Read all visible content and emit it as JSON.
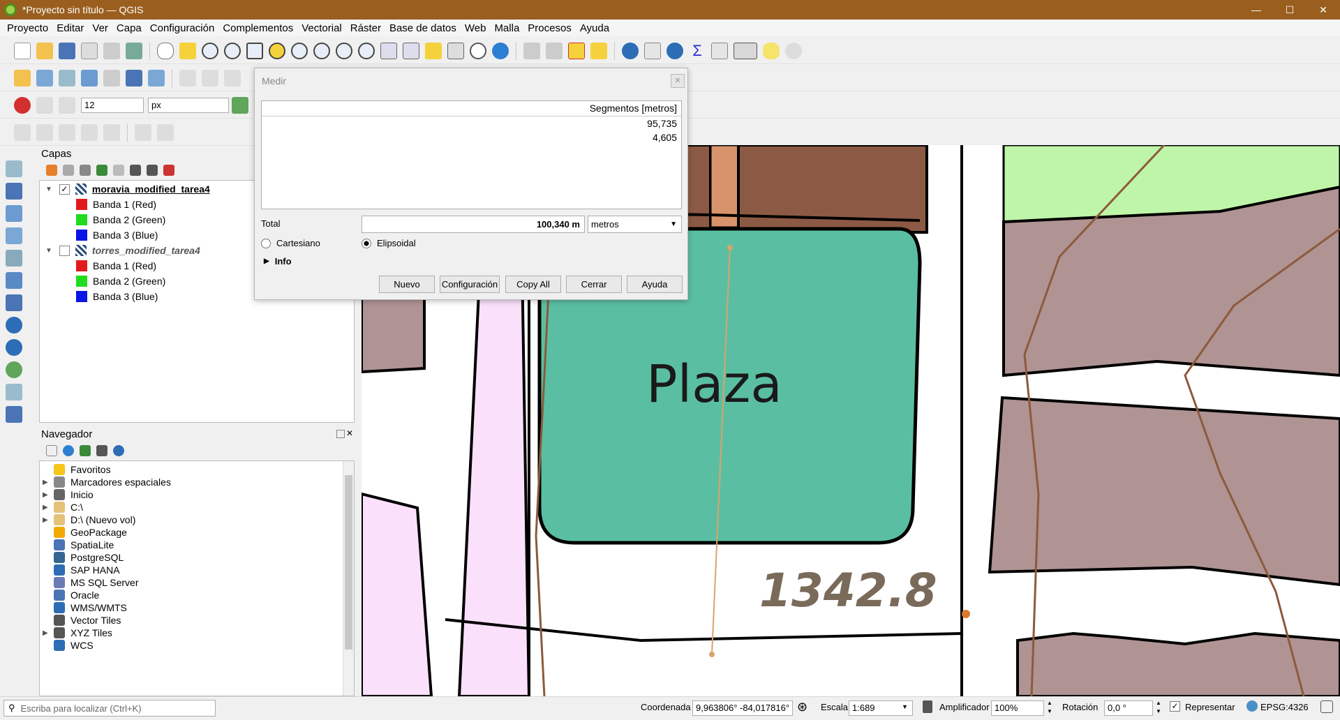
{
  "window": {
    "title": "*Proyecto sin título — QGIS",
    "min": "—",
    "max": "☐",
    "close": "✕"
  },
  "menu": [
    "Proyecto",
    "Editar",
    "Ver",
    "Capa",
    "Configuración",
    "Complementos",
    "Vectorial",
    "Ráster",
    "Base de datos",
    "Web",
    "Malla",
    "Procesos",
    "Ayuda"
  ],
  "snapping": {
    "tolerance": "12",
    "unit": "px"
  },
  "layers_panel": {
    "title": "Capas",
    "layers": [
      {
        "name": "moravia_modified_tarea4",
        "checked": true,
        "bands": [
          {
            "label": "Banda 1 (Red)",
            "color": "#e31a1c"
          },
          {
            "label": "Banda 2 (Green)",
            "color": "#1fdc1f"
          },
          {
            "label": "Banda 3 (Blue)",
            "color": "#0a14e6"
          }
        ]
      },
      {
        "name": "torres_modified_tarea4",
        "checked": false,
        "bands": [
          {
            "label": "Banda 1 (Red)",
            "color": "#e31a1c"
          },
          {
            "label": "Banda 2 (Green)",
            "color": "#1fdc1f"
          },
          {
            "label": "Banda 3 (Blue)",
            "color": "#0a14e6"
          }
        ]
      }
    ]
  },
  "browser_panel": {
    "title": "Navegador",
    "items": [
      {
        "label": "Favoritos",
        "icon": "star-icon",
        "expand": false
      },
      {
        "label": "Marcadores espaciales",
        "icon": "bookmark-icon",
        "expand": true
      },
      {
        "label": "Inicio",
        "icon": "home-icon",
        "expand": true
      },
      {
        "label": "C:\\",
        "icon": "folder-icon",
        "expand": true
      },
      {
        "label": "D:\\ (Nuevo vol)",
        "icon": "folder-icon",
        "expand": true
      },
      {
        "label": "GeoPackage",
        "icon": "geopackage-icon",
        "expand": false
      },
      {
        "label": "SpatiaLite",
        "icon": "spatialite-icon",
        "expand": false
      },
      {
        "label": "PostgreSQL",
        "icon": "postgresql-icon",
        "expand": false
      },
      {
        "label": "SAP HANA",
        "icon": "saphana-icon",
        "expand": false
      },
      {
        "label": "MS SQL Server",
        "icon": "mssql-icon",
        "expand": false
      },
      {
        "label": "Oracle",
        "icon": "oracle-icon",
        "expand": false
      },
      {
        "label": "WMS/WMTS",
        "icon": "globe-icon",
        "expand": false
      },
      {
        "label": "Vector Tiles",
        "icon": "grid-icon",
        "expand": false
      },
      {
        "label": "XYZ Tiles",
        "icon": "grid-icon",
        "expand": true
      },
      {
        "label": "WCS",
        "icon": "globe-icon",
        "expand": false
      }
    ]
  },
  "measure_dialog": {
    "title": "Medir",
    "column_header": "Segmentos [metros]",
    "segments": [
      "95,735",
      "4,605"
    ],
    "total_label": "Total",
    "total_value": "100,340 m",
    "unit": "metros",
    "cartesian_label": "Cartesiano",
    "ellipsoidal_label": "Elipsoidal",
    "info_label": "Info",
    "buttons": {
      "new": "Nuevo",
      "config": "Configuración",
      "copy": "Copy All",
      "close": "Cerrar",
      "help": "Ayuda"
    }
  },
  "map": {
    "label_plaza": "Plaza",
    "label_elevation": "1342.8"
  },
  "statusbar": {
    "locate_placeholder": "Escriba para localizar (Ctrl+K)",
    "coord_label": "Coordenada",
    "coord_value": "9,963806° -84,017816°",
    "scale_label": "Escala",
    "scale_value": "1:689",
    "magnifier_label": "Amplificador",
    "magnifier_value": "100%",
    "rotation_label": "Rotación",
    "rotation_value": "0,0 °",
    "render_label": "Representar",
    "crs": "EPSG:4326"
  }
}
